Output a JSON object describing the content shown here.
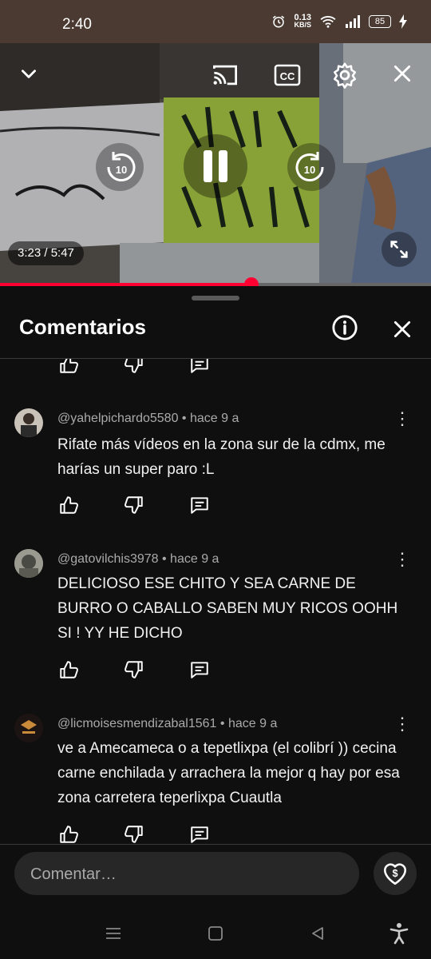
{
  "status_bar": {
    "time": "2:40",
    "net_speed_value": "0.13",
    "net_speed_unit": "KB/S",
    "battery": "85"
  },
  "player": {
    "time_display": "3:23 / 5:47",
    "progress_fraction": 0.584,
    "seek_back_seconds": "10",
    "seek_forward_seconds": "10",
    "cc_label": "CC",
    "icons": [
      "chevron-down-icon",
      "cast-icon",
      "cc-icon",
      "settings-icon",
      "close-icon",
      "rewind-icon",
      "pause-icon",
      "forward-icon",
      "fullscreen-icon"
    ]
  },
  "comments_sheet": {
    "title": "Comentarios",
    "comments": [
      {
        "author": "@yahelpichardo5580",
        "age": "hace 9 a",
        "text": "Rifate más vídeos en la zona sur de la cdmx, me harías un super paro :L"
      },
      {
        "author": "@gatovilchis3978",
        "age": "hace 9 a",
        "text": "DELICIOSO ESE CHITO Y SEA CARNE DE BURRO O CABALLO SABEN MUY RICOS OOHH SI ! YY HE DICHO"
      },
      {
        "author": "@licmoisesmendizabal1561",
        "age": "hace 9 a",
        "text": "ve a Amecameca o a tepetlixpa (el colibrí )) cecina carne enchilada y arrachera la mejor q hay por esa zona carretera teperlixpa Cuautla"
      }
    ],
    "input_placeholder": "Comentar…"
  },
  "colors": {
    "accent": "#ff0033",
    "background": "#0f0f0f",
    "status_bar": "#4a3a32"
  }
}
